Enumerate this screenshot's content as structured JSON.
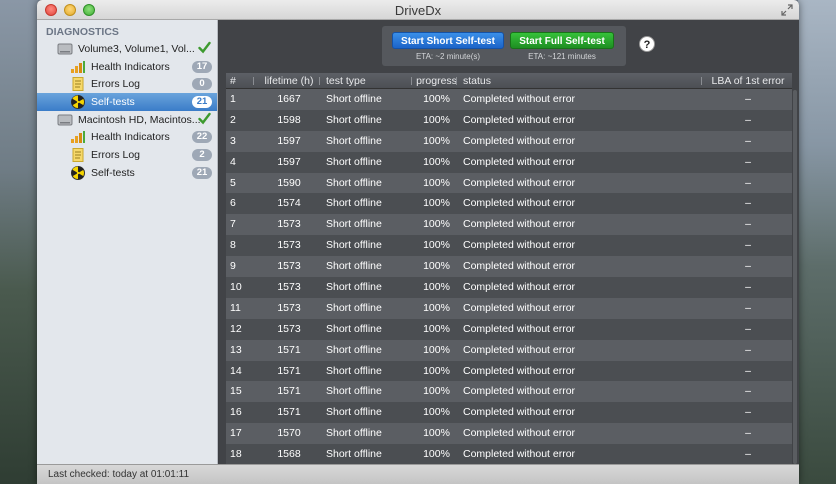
{
  "window": {
    "title": "DriveDx"
  },
  "sidebar": {
    "section_label": "DIAGNOSTICS",
    "disks": [
      {
        "name": "Volume3, Volume1, Vol...",
        "ok": true,
        "items": [
          {
            "label": "Health Indicators",
            "badge": "17",
            "icon": "bar-chart-icon"
          },
          {
            "label": "Errors Log",
            "badge": "0",
            "icon": "log-document-icon"
          },
          {
            "label": "Self-tests",
            "badge": "21",
            "icon": "radiation-icon",
            "selected": true
          }
        ]
      },
      {
        "name": "Macintosh HD, Macintos...",
        "ok": true,
        "items": [
          {
            "label": "Health Indicators",
            "badge": "22",
            "icon": "bar-chart-icon"
          },
          {
            "label": "Errors Log",
            "badge": "2",
            "icon": "log-document-icon"
          },
          {
            "label": "Self-tests",
            "badge": "21",
            "icon": "radiation-icon"
          }
        ]
      }
    ]
  },
  "controls": {
    "short_button": "Start Short Self-test",
    "short_eta": "ETA: ~2 minute(s)",
    "full_button": "Start Full Self-test",
    "full_eta": "ETA: ~121 minutes",
    "help": "?"
  },
  "table": {
    "columns": [
      "#",
      "lifetime (h)",
      "test type",
      "progress",
      "status",
      "LBA of 1st error"
    ],
    "rows": [
      [
        "1",
        "1667",
        "Short offline",
        "100%",
        "Completed without error",
        "–"
      ],
      [
        "2",
        "1598",
        "Short offline",
        "100%",
        "Completed without error",
        "–"
      ],
      [
        "3",
        "1597",
        "Short offline",
        "100%",
        "Completed without error",
        "–"
      ],
      [
        "4",
        "1597",
        "Short offline",
        "100%",
        "Completed without error",
        "–"
      ],
      [
        "5",
        "1590",
        "Short offline",
        "100%",
        "Completed without error",
        "–"
      ],
      [
        "6",
        "1574",
        "Short offline",
        "100%",
        "Completed without error",
        "–"
      ],
      [
        "7",
        "1573",
        "Short offline",
        "100%",
        "Completed without error",
        "–"
      ],
      [
        "8",
        "1573",
        "Short offline",
        "100%",
        "Completed without error",
        "–"
      ],
      [
        "9",
        "1573",
        "Short offline",
        "100%",
        "Completed without error",
        "–"
      ],
      [
        "10",
        "1573",
        "Short offline",
        "100%",
        "Completed without error",
        "–"
      ],
      [
        "11",
        "1573",
        "Short offline",
        "100%",
        "Completed without error",
        "–"
      ],
      [
        "12",
        "1573",
        "Short offline",
        "100%",
        "Completed without error",
        "–"
      ],
      [
        "13",
        "1571",
        "Short offline",
        "100%",
        "Completed without error",
        "–"
      ],
      [
        "14",
        "1571",
        "Short offline",
        "100%",
        "Completed without error",
        "–"
      ],
      [
        "15",
        "1571",
        "Short offline",
        "100%",
        "Completed without error",
        "–"
      ],
      [
        "16",
        "1571",
        "Short offline",
        "100%",
        "Completed without error",
        "–"
      ],
      [
        "17",
        "1570",
        "Short offline",
        "100%",
        "Completed without error",
        "–"
      ],
      [
        "18",
        "1568",
        "Short offline",
        "100%",
        "Completed without error",
        "–"
      ]
    ]
  },
  "statusbar": {
    "text": "Last checked: today at 01:01:11"
  }
}
